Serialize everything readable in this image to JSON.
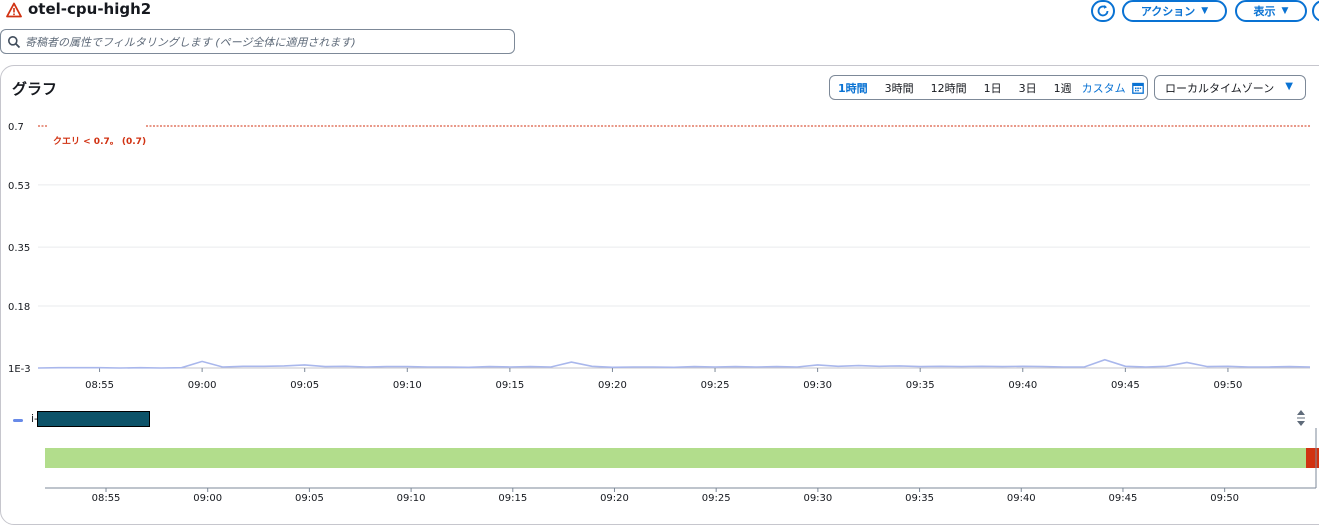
{
  "header": {
    "title": "otel-cpu-high2",
    "actions_label": "アクション",
    "view_label": "表示"
  },
  "filter": {
    "placeholder": "寄稿者の属性でフィルタリングします (ページ全体に適用されます)"
  },
  "graph": {
    "title": "グラフ",
    "ranges": [
      "1時間",
      "3時間",
      "12時間",
      "1日",
      "3日",
      "1週"
    ],
    "active_range": "1時間",
    "custom_label": "カスタム",
    "timezone_label": "ローカルタイムゾーン"
  },
  "legend": {
    "prefix": "i-"
  },
  "colors": {
    "accent": "#0972d3",
    "series": "#a9b7ec",
    "threshold": "#d13212",
    "ok_band": "#b2dd8c",
    "alarm_band": "#d13212"
  },
  "chart_data": {
    "type": "line",
    "title": "",
    "xlabel": "",
    "ylabel": "",
    "x_start": "08:52",
    "x_end": "09:54",
    "yticks": [
      "0.7",
      "0.53",
      "0.35",
      "0.18",
      "1E-3"
    ],
    "ytick_values": [
      0.7,
      0.53,
      0.35,
      0.18,
      0.001
    ],
    "ylim": [
      0.001,
      0.7
    ],
    "xticks": [
      "08:55",
      "09:00",
      "09:05",
      "09:10",
      "09:15",
      "09:20",
      "09:25",
      "09:30",
      "09:35",
      "09:40",
      "09:45",
      "09:50"
    ],
    "threshold": {
      "value": 0.7,
      "label": "クエリ < 0.7。 (0.7)"
    },
    "series": [
      {
        "x": [
          "08:52",
          "08:53",
          "08:54",
          "08:55",
          "08:56",
          "08:57",
          "08:58",
          "08:59",
          "09:00",
          "09:01",
          "09:02",
          "09:03",
          "09:04",
          "09:05",
          "09:06",
          "09:07",
          "09:08",
          "09:09",
          "09:10",
          "09:11",
          "09:12",
          "09:13",
          "09:14",
          "09:15",
          "09:16",
          "09:17",
          "09:18",
          "09:19",
          "09:20",
          "09:21",
          "09:22",
          "09:23",
          "09:24",
          "09:25",
          "09:26",
          "09:27",
          "09:28",
          "09:29",
          "09:30",
          "09:31",
          "09:32",
          "09:33",
          "09:34",
          "09:35",
          "09:36",
          "09:37",
          "09:38",
          "09:39",
          "09:40",
          "09:41",
          "09:42",
          "09:43",
          "09:44",
          "09:45",
          "09:46",
          "09:47",
          "09:48",
          "09:49",
          "09:50",
          "09:51",
          "09:52",
          "09:53",
          "09:54"
        ],
        "values": [
          0.001,
          0.002,
          0.002,
          0.002,
          0.001,
          0.002,
          0.001,
          0.002,
          0.02,
          0.004,
          0.006,
          0.006,
          0.007,
          0.01,
          0.005,
          0.006,
          0.004,
          0.005,
          0.005,
          0.004,
          0.004,
          0.003,
          0.005,
          0.004,
          0.005,
          0.004,
          0.018,
          0.006,
          0.003,
          0.004,
          0.004,
          0.003,
          0.005,
          0.004,
          0.005,
          0.004,
          0.005,
          0.004,
          0.01,
          0.006,
          0.008,
          0.006,
          0.007,
          0.005,
          0.006,
          0.005,
          0.006,
          0.005,
          0.006,
          0.005,
          0.004,
          0.004,
          0.025,
          0.006,
          0.004,
          0.006,
          0.017,
          0.005,
          0.006,
          0.004,
          0.004,
          0.005,
          0.004
        ]
      }
    ],
    "timeline": {
      "bands": [
        {
          "state": "OK",
          "start": "08:52",
          "end": "09:54"
        },
        {
          "state": "ALARM",
          "start": "09:54",
          "end": "09:54"
        }
      ]
    }
  }
}
